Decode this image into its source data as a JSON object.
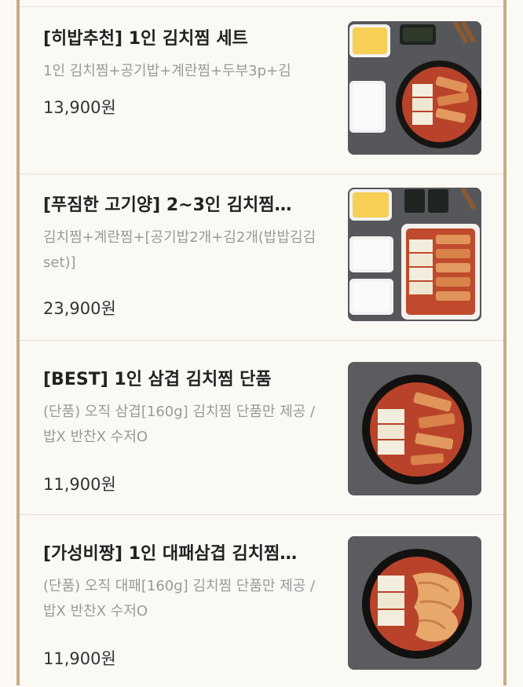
{
  "menu": {
    "items": [
      {
        "title": "[히밥추천] 1인 김치찜 세트",
        "description": "1인 김치찜+공기밥+계란찜+두부3p+김",
        "price": "13,900원",
        "image_icon": "kimchi-jjim-set-photo"
      },
      {
        "title": "[푸짐한 고기양] 2~3인 김치찜…",
        "description": "김치찜+계란찜+[공기밥2개+김2개(밥밥김김set)]",
        "price": "23,900원",
        "image_icon": "kimchi-jjim-large-set-photo"
      },
      {
        "title": "[BEST] 1인 삼겹 김치찜 단품",
        "description": "(단품) 오직 삼겹[160g] 김치찜 단품만 제공 / 밥X 반찬X 수저O",
        "price": "11,900원",
        "image_icon": "samgyeop-kimchi-jjim-photo"
      },
      {
        "title": "[가성비짱] 1인 대패삼겹 김치찜…",
        "description": "(단품) 오직 대패[160g] 김치찜 단품만 제공 / 밥X 반찬X 수저O",
        "price": "11,900원",
        "image_icon": "daepae-kimchi-jjim-photo"
      }
    ]
  },
  "colors": {
    "rail": "#c9ab85",
    "background": "#fbf9f4",
    "divider": "#e7ddd1",
    "title": "#222222",
    "description": "#9a9a9a"
  }
}
